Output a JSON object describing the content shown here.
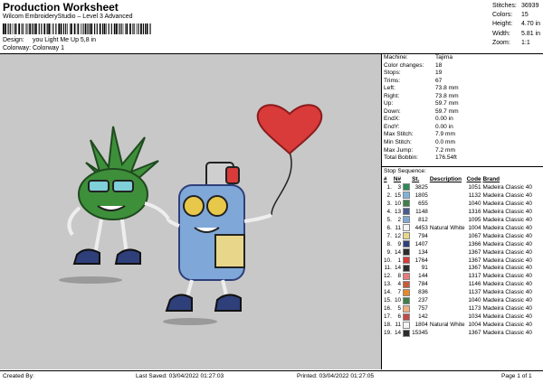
{
  "header": {
    "title": "Production Worksheet",
    "subtitle": "Wilcom EmbroideryStudio – Level 3 Advanced",
    "design_label": "Design:",
    "design_value": "you Light Me Up 5,8 in",
    "colorway_label": "Colorway:",
    "colorway_value": "Colorway 1"
  },
  "top_stats": [
    {
      "label": "Stitches:",
      "value": "36939"
    },
    {
      "label": "Colors:",
      "value": "15"
    },
    {
      "label": "Height:",
      "value": "4.70 in"
    },
    {
      "label": "Width:",
      "value": "5.81 in"
    },
    {
      "label": "Zoom:",
      "value": "1:1"
    }
  ],
  "machine_stats": [
    {
      "label": "Machine:",
      "value": "Tajima"
    },
    {
      "label": "Color changes:",
      "value": "18"
    },
    {
      "label": "Stops:",
      "value": "19"
    },
    {
      "label": "Trims:",
      "value": "67"
    },
    {
      "label": "Left:",
      "value": "73.8 mm"
    },
    {
      "label": "Right:",
      "value": "73.8 mm"
    },
    {
      "label": "Up:",
      "value": "59.7 mm"
    },
    {
      "label": "Down:",
      "value": "59.7 mm"
    },
    {
      "label": "EndX:",
      "value": "0.00 in"
    },
    {
      "label": "EndY:",
      "value": "0.00 in"
    },
    {
      "label": "Max Stitch:",
      "value": "7.9 mm"
    },
    {
      "label": "Min Stitch:",
      "value": "0.0 mm"
    },
    {
      "label": "Max Jump:",
      "value": "7.2 mm"
    },
    {
      "label": "Total Bobbin:",
      "value": "176.54ft"
    }
  ],
  "stop_sequence": {
    "title": "Stop Sequence:",
    "headers": [
      "#",
      "N#",
      "",
      "St.",
      "Description",
      "Code",
      "Brand"
    ],
    "rows": [
      {
        "n": "1.",
        "nn": "3",
        "color": "#2e8b57",
        "st": "3825",
        "desc": "",
        "code": "1051",
        "brand": "Madeira Classic 40"
      },
      {
        "n": "2.",
        "nn": "15",
        "color": "#7fb2d9",
        "st": "1805",
        "desc": "",
        "code": "1132",
        "brand": "Madeira Classic 40"
      },
      {
        "n": "3.",
        "nn": "10",
        "color": "#3e7f4a",
        "st": "655",
        "desc": "",
        "code": "1040",
        "brand": "Madeira Classic 40"
      },
      {
        "n": "4.",
        "nn": "13",
        "color": "#4a5a8f",
        "st": "1148",
        "desc": "",
        "code": "1316",
        "brand": "Madeira Classic 40"
      },
      {
        "n": "5.",
        "nn": "2",
        "color": "#7fa8d8",
        "st": "812",
        "desc": "",
        "code": "1095",
        "brand": "Madeira Classic 40"
      },
      {
        "n": "6.",
        "nn": "11",
        "color": "#f4f4f4",
        "st": "4453",
        "desc": "Natural White",
        "code": "1004",
        "brand": "Madeira Classic 40"
      },
      {
        "n": "7.",
        "nn": "12",
        "color": "#e8d68a",
        "st": "794",
        "desc": "",
        "code": "1067",
        "brand": "Madeira Classic 40"
      },
      {
        "n": "8.",
        "nn": "9",
        "color": "#2f3f7a",
        "st": "1407",
        "desc": "",
        "code": "1366",
        "brand": "Madeira Classic 40"
      },
      {
        "n": "9.",
        "nn": "14",
        "color": "#2c2c2c",
        "st": "134",
        "desc": "",
        "code": "1367",
        "brand": "Madeira Classic 40"
      },
      {
        "n": "10.",
        "nn": "1",
        "color": "#d93a3a",
        "st": "1764",
        "desc": "",
        "code": "1367",
        "brand": "Madeira Classic 40"
      },
      {
        "n": "11.",
        "nn": "14",
        "color": "#2c2c2c",
        "st": "91",
        "desc": "",
        "code": "1367",
        "brand": "Madeira Classic 40"
      },
      {
        "n": "12.",
        "nn": "8",
        "color": "#e97a7a",
        "st": "144",
        "desc": "",
        "code": "1317",
        "brand": "Madeira Classic 40"
      },
      {
        "n": "13.",
        "nn": "4",
        "color": "#c85a3a",
        "st": "784",
        "desc": "",
        "code": "1146",
        "brand": "Madeira Classic 40"
      },
      {
        "n": "14.",
        "nn": "7",
        "color": "#e8872e",
        "st": "836",
        "desc": "",
        "code": "1137",
        "brand": "Madeira Classic 40"
      },
      {
        "n": "15.",
        "nn": "10",
        "color": "#3e7f4a",
        "st": "237",
        "desc": "",
        "code": "1040",
        "brand": "Madeira Classic 40"
      },
      {
        "n": "16.",
        "nn": "5",
        "color": "#f0b080",
        "st": "757",
        "desc": "",
        "code": "1173",
        "brand": "Madeira Classic 40"
      },
      {
        "n": "17.",
        "nn": "6",
        "color": "#c04a4a",
        "st": "142",
        "desc": "",
        "code": "1034",
        "brand": "Madeira Classic 40"
      },
      {
        "n": "18.",
        "nn": "11",
        "color": "#f4f4f4",
        "st": "1804",
        "desc": "Natural White",
        "code": "1004",
        "brand": "Madeira Classic 40"
      },
      {
        "n": "19.",
        "nn": "14",
        "color": "#2c2c2c",
        "st": "15345",
        "desc": "",
        "code": "1367",
        "brand": "Madeira Classic 40"
      }
    ]
  },
  "footer": {
    "created_by": "Created By:",
    "last_saved": "Last Saved: 03/04/2022 01:27:03",
    "printed": "Printed: 03/04/2022 01:27:05",
    "page": "Page 1 of 1"
  },
  "colors": {
    "canvas_bg": "#c8c8c8"
  }
}
